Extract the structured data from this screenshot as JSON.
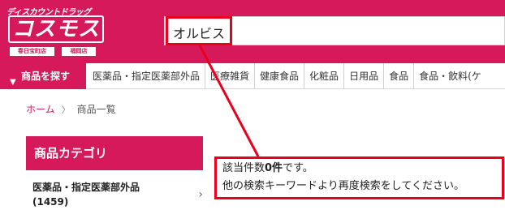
{
  "header": {
    "logo_tagline": "ディスカウントドラッグ",
    "logo_name": "コスモス",
    "store_1": "春日宝町店",
    "store_2": "福岡店"
  },
  "search": {
    "value": "オルビス"
  },
  "nav": {
    "search_label": "商品を探す",
    "items": [
      "医薬品・指定医薬部外品",
      "医療雑貨",
      "健康食品",
      "化粧品",
      "日用品",
      "食品",
      "食品・飲料(ケ"
    ]
  },
  "breadcrumb": {
    "home": "ホーム",
    "separator": "〉",
    "current": "商品一覧"
  },
  "sidebar": {
    "heading": "商品カテゴリ",
    "items": [
      {
        "label": "医薬品・指定医薬部外品",
        "count": "(1459)"
      }
    ]
  },
  "result": {
    "prefix": "該当件数",
    "count": "0件",
    "suffix": "です。",
    "line2": "他の検索キーワードより再度検索をしてください。"
  },
  "colors": {
    "brand": "#d6195b",
    "annotation": "#e8001e"
  },
  "icons": {
    "nav_search": "location-pin-icon",
    "sidebar_arrow": "chevron-right-icon"
  }
}
